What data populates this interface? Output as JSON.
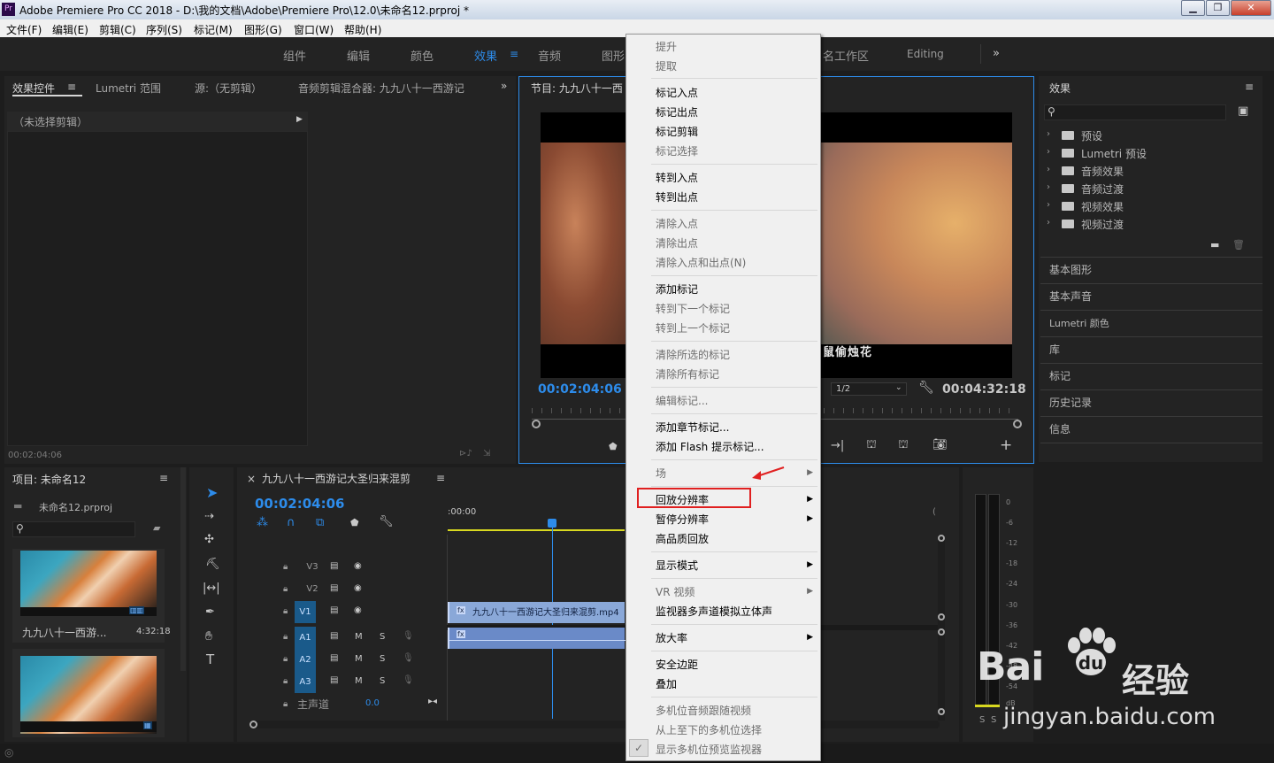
{
  "window": {
    "title": "Adobe Premiere Pro CC 2018 - D:\\我的文档\\Adobe\\Premiere Pro\\12.0\\未命名12.prproj *",
    "logo": "Pr",
    "min": "▁",
    "max": "❐",
    "close": "✕"
  },
  "menubar": [
    "文件(F)",
    "编辑(E)",
    "剪辑(C)",
    "序列(S)",
    "标记(M)",
    "图形(G)",
    "窗口(W)",
    "帮助(H)"
  ],
  "workspaces": {
    "items": [
      "组件",
      "编辑",
      "颜色",
      "效果",
      "音频",
      "图形",
      "名工作区",
      "Editing"
    ],
    "active": "效果",
    "more": "»"
  },
  "source_panel": {
    "tabs": [
      "效果控件",
      "Lumetri 范围",
      "源:（无剪辑）",
      "音频剪辑混合器: 九九八十一西游记"
    ],
    "no_clip": "（未选择剪辑）",
    "timecode": "00:02:04:06"
  },
  "program_monitor": {
    "title": "节目: 九九八十一西",
    "timecode_left": "00:02:04:06",
    "resolution": "1/2",
    "timecode_right": "00:04:32:18",
    "subtitle": "鼠偷烛花"
  },
  "context_menu": {
    "groups": [
      [
        {
          "label": "提升",
          "enabled": false
        },
        {
          "label": "提取",
          "enabled": false
        }
      ],
      [
        {
          "label": "标记入点",
          "enabled": true
        },
        {
          "label": "标记出点",
          "enabled": true
        },
        {
          "label": "标记剪辑",
          "enabled": true
        },
        {
          "label": "标记选择",
          "enabled": false
        }
      ],
      [
        {
          "label": "转到入点",
          "enabled": true
        },
        {
          "label": "转到出点",
          "enabled": true
        }
      ],
      [
        {
          "label": "清除入点",
          "enabled": false
        },
        {
          "label": "清除出点",
          "enabled": false
        },
        {
          "label": "清除入点和出点(N)",
          "enabled": false
        }
      ],
      [
        {
          "label": "添加标记",
          "enabled": true
        },
        {
          "label": "转到下一个标记",
          "enabled": false
        },
        {
          "label": "转到上一个标记",
          "enabled": false
        }
      ],
      [
        {
          "label": "清除所选的标记",
          "enabled": false
        },
        {
          "label": "清除所有标记",
          "enabled": false
        }
      ],
      [
        {
          "label": "编辑标记...",
          "enabled": false
        }
      ],
      [
        {
          "label": "添加章节标记...",
          "enabled": true
        },
        {
          "label": "添加 Flash 提示标记...",
          "enabled": true
        }
      ],
      [
        {
          "label": "场",
          "enabled": false,
          "submenu": true
        }
      ],
      [
        {
          "label": "回放分辨率",
          "enabled": true,
          "submenu": true,
          "highlighted": true
        },
        {
          "label": "暂停分辨率",
          "enabled": true,
          "submenu": true
        },
        {
          "label": "高品质回放",
          "enabled": true
        }
      ],
      [
        {
          "label": "显示模式",
          "enabled": true,
          "submenu": true
        }
      ],
      [
        {
          "label": "VR 视频",
          "enabled": false,
          "submenu": true
        },
        {
          "label": "监视器多声道模拟立体声",
          "enabled": true
        }
      ],
      [
        {
          "label": "放大率",
          "enabled": true,
          "submenu": true
        }
      ],
      [
        {
          "label": "安全边距",
          "enabled": true
        },
        {
          "label": "叠加",
          "enabled": true
        }
      ],
      [
        {
          "label": "多机位音频跟随视频",
          "enabled": false
        },
        {
          "label": "从上至下的多机位选择",
          "enabled": false
        },
        {
          "label": "显示多机位预览监视器",
          "enabled": false,
          "checked": true
        }
      ]
    ]
  },
  "effects_panel": {
    "title": "效果",
    "items": [
      "预设",
      "Lumetri 预设",
      "音频效果",
      "音频过渡",
      "视频效果",
      "视频过渡"
    ],
    "sections": [
      "基本图形",
      "基本声音",
      "Lumetri 颜色",
      "库",
      "标记",
      "历史记录",
      "信息"
    ]
  },
  "project_panel": {
    "title": "项目: 未命名12",
    "file": "未命名12.prproj",
    "clip_name": "九九八十一西游...",
    "clip_duration": "4:32:18"
  },
  "timeline": {
    "title": "九九八十一西游记大圣归来混剪",
    "timecode": "00:02:04:06",
    "ruler_start": ":00:00",
    "tracks": [
      "V3",
      "V2",
      "V1",
      "A1",
      "A2",
      "A3"
    ],
    "master": "主声道",
    "master_value": "0.0",
    "clip_label": "九九八十一西游记大圣归来混剪.mp4"
  },
  "meter": {
    "labels": [
      "0",
      "-6",
      "-12",
      "-18",
      "-24",
      "-30",
      "-36",
      "-42",
      "-48",
      "-54",
      "dB"
    ],
    "sm": "S"
  },
  "watermark": {
    "brand": "Bai",
    "brand2": "经验",
    "url": "jingyan.baidu.com"
  },
  "colors": {
    "accent": "#2d8ceb",
    "highlight_box": "#e02020",
    "arrow": "#e02020"
  }
}
